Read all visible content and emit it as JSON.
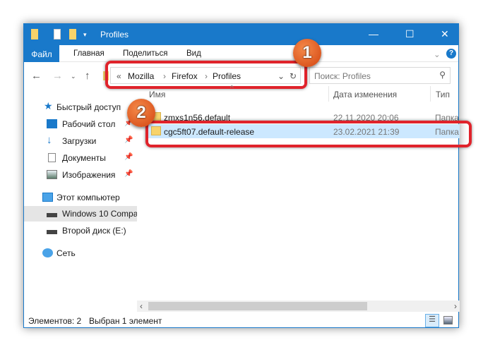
{
  "window": {
    "title": "Profiles"
  },
  "ribbon": {
    "tabs": [
      "Файл",
      "Главная",
      "Поделиться",
      "Вид"
    ]
  },
  "address": {
    "overflow": "«",
    "path": [
      "Mozilla",
      "Firefox",
      "Profiles"
    ],
    "search_placeholder": "Поиск: Profiles"
  },
  "sidebar": {
    "items": [
      {
        "label": "Быстрый доступ",
        "icon": "star-icon"
      },
      {
        "label": "Рабочий стол",
        "icon": "desktop-icon",
        "pinned": true
      },
      {
        "label": "Загрузки",
        "icon": "download-icon",
        "pinned": true
      },
      {
        "label": "Документы",
        "icon": "documents-icon",
        "pinned": true
      },
      {
        "label": "Изображения",
        "icon": "pictures-icon",
        "pinned": true
      },
      {
        "label": "Этот компьютер",
        "icon": "computer-icon"
      },
      {
        "label": "Windows 10 Compa",
        "icon": "drive-icon"
      },
      {
        "label": "Второй диск (E:)",
        "icon": "drive-icon"
      },
      {
        "label": "Сеть",
        "icon": "network-icon"
      }
    ]
  },
  "columns": [
    "Имя",
    "Дата изменения",
    "Тип"
  ],
  "files": [
    {
      "name": "zmxs1n56.default",
      "date": "22.11.2020 20:06",
      "type": "Папка"
    },
    {
      "name": "cgc5ft07.default-release",
      "date": "23.02.2021 21:39",
      "type": "Папка"
    }
  ],
  "annotations": [
    "1",
    "2"
  ],
  "status": {
    "count": "Элементов: 2",
    "selected": "Выбран 1 элемент"
  },
  "colors": {
    "accent": "#1979ca",
    "highlight": "#e0232b",
    "selection": "#cce8ff"
  }
}
